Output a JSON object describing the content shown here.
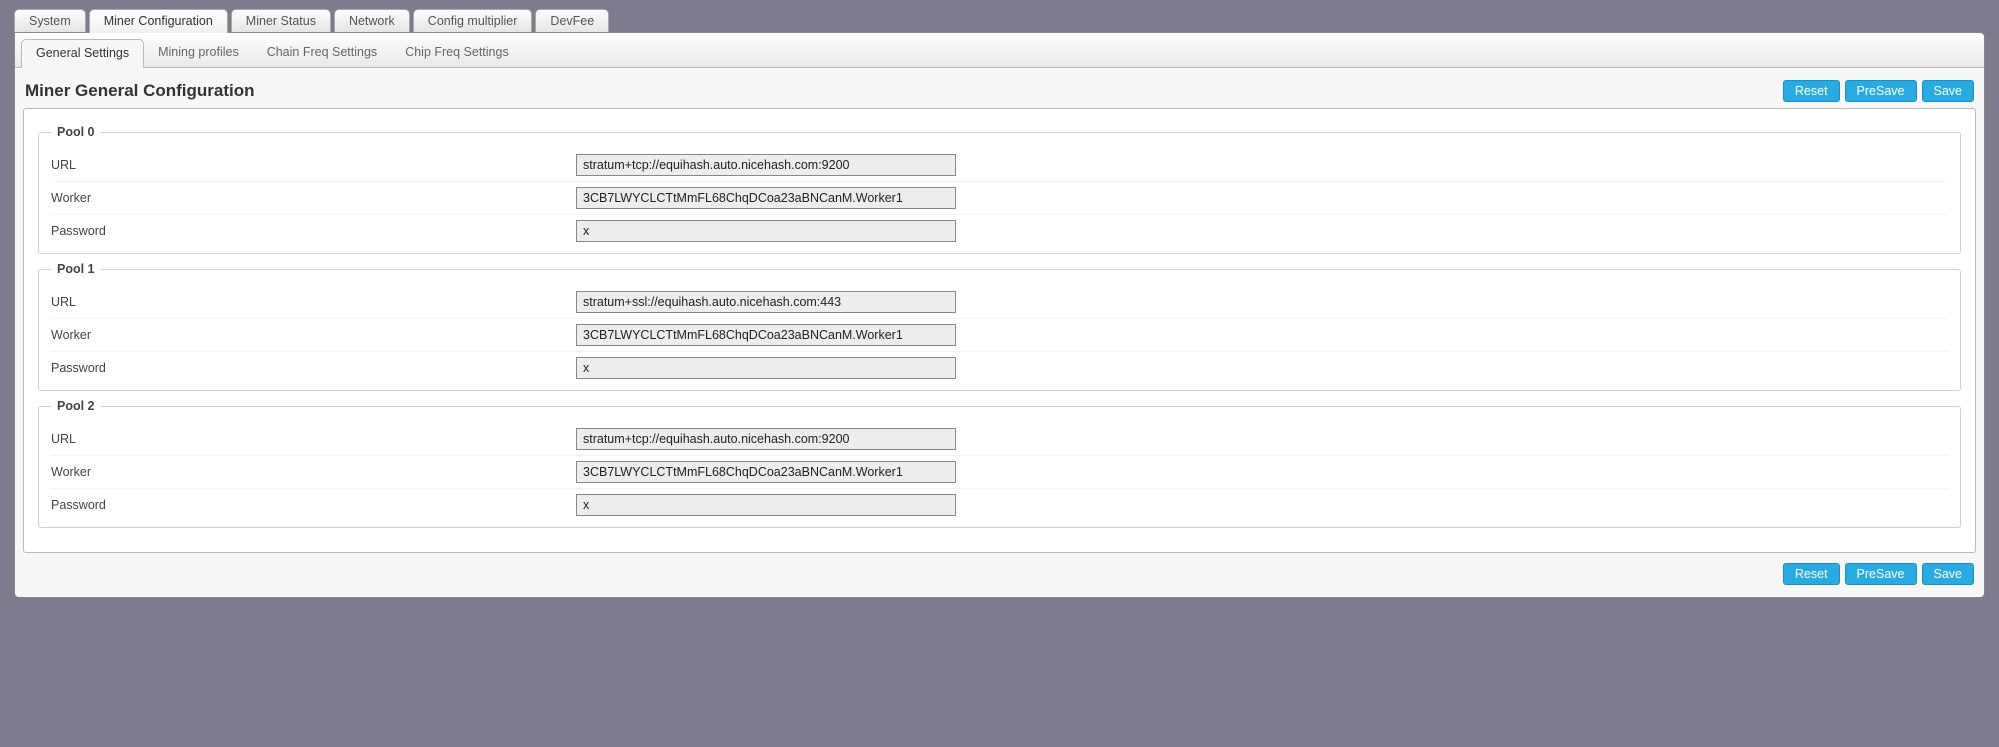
{
  "mainTabs": [
    {
      "label": "System",
      "active": false
    },
    {
      "label": "Miner Configuration",
      "active": true
    },
    {
      "label": "Miner Status",
      "active": false
    },
    {
      "label": "Network",
      "active": false
    },
    {
      "label": "Config multiplier",
      "active": false
    },
    {
      "label": "DevFee",
      "active": false
    }
  ],
  "subTabs": [
    {
      "label": "General Settings",
      "active": true
    },
    {
      "label": "Mining profiles",
      "active": false
    },
    {
      "label": "Chain Freq Settings",
      "active": false
    },
    {
      "label": "Chip Freq Settings",
      "active": false
    }
  ],
  "pageTitle": "Miner General Configuration",
  "buttons": {
    "reset": "Reset",
    "presave": "PreSave",
    "save": "Save"
  },
  "fieldLabels": {
    "url": "URL",
    "worker": "Worker",
    "password": "Password"
  },
  "pools": [
    {
      "legend": "Pool 0",
      "url": "stratum+tcp://equihash.auto.nicehash.com:9200",
      "worker": "3CB7LWYCLCTtMmFL68ChqDCoa23aBNCanM.Worker1",
      "password": "x"
    },
    {
      "legend": "Pool 1",
      "url": "stratum+ssl://equihash.auto.nicehash.com:443",
      "worker": "3CB7LWYCLCTtMmFL68ChqDCoa23aBNCanM.Worker1",
      "password": "x"
    },
    {
      "legend": "Pool 2",
      "url": "stratum+tcp://equihash.auto.nicehash.com:9200",
      "worker": "3CB7LWYCLCTtMmFL68ChqDCoa23aBNCanM.Worker1",
      "password": "x"
    }
  ]
}
